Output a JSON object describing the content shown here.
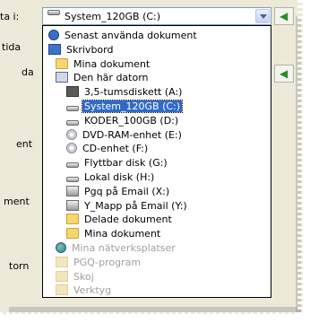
{
  "window": {
    "look_in_label": "ta i:",
    "selected_location": "System_120GB (C:)"
  },
  "left_labels": [
    "tida",
    "da",
    "ent",
    "ment",
    "torn"
  ],
  "dropdown": {
    "items": [
      {
        "label": "Senast använda dokument",
        "icon": "recent-documents-icon",
        "indent": 0,
        "selected": false,
        "dim": false
      },
      {
        "label": "Skrivbord",
        "icon": "desktop-icon",
        "indent": 0,
        "selected": false,
        "dim": false
      },
      {
        "label": "Mina dokument",
        "icon": "folder-icon",
        "indent": 1,
        "selected": false,
        "dim": false
      },
      {
        "label": "Den här datorn",
        "icon": "computer-icon",
        "indent": 1,
        "selected": false,
        "dim": false
      },
      {
        "label": "3,5-tumsdiskett (A:)",
        "icon": "floppy-drive-icon",
        "indent": 2,
        "selected": false,
        "dim": false
      },
      {
        "label": "System_120GB (C:)",
        "icon": "hard-drive-icon",
        "indent": 2,
        "selected": true,
        "dim": false
      },
      {
        "label": "KODER_100GB (D:)",
        "icon": "hard-drive-icon",
        "indent": 2,
        "selected": false,
        "dim": false
      },
      {
        "label": "DVD-RAM-enhet (E:)",
        "icon": "dvd-drive-icon",
        "indent": 2,
        "selected": false,
        "dim": false
      },
      {
        "label": "CD-enhet (F:)",
        "icon": "cd-drive-icon",
        "indent": 2,
        "selected": false,
        "dim": false
      },
      {
        "label": "Flyttbar disk (G:)",
        "icon": "removable-disk-icon",
        "indent": 2,
        "selected": false,
        "dim": false
      },
      {
        "label": "Lokal disk (H:)",
        "icon": "hard-drive-icon",
        "indent": 2,
        "selected": false,
        "dim": false
      },
      {
        "label": "Pgq på Email (X:)",
        "icon": "network-drive-icon",
        "indent": 2,
        "selected": false,
        "dim": false
      },
      {
        "label": "Y_Mapp på Email (Y:)",
        "icon": "network-drive-icon",
        "indent": 2,
        "selected": false,
        "dim": false
      },
      {
        "label": "Delade dokument",
        "icon": "folder-icon",
        "indent": 2,
        "selected": false,
        "dim": false
      },
      {
        "label": "Mina dokument",
        "icon": "folder-icon",
        "indent": 2,
        "selected": false,
        "dim": false
      },
      {
        "label": "Mina nätverksplatser",
        "icon": "network-places-icon",
        "indent": 1,
        "selected": false,
        "dim": true
      },
      {
        "label": "PGQ-program",
        "icon": "folder-icon",
        "indent": 1,
        "selected": false,
        "dim": true
      },
      {
        "label": "Skoj",
        "icon": "folder-icon",
        "indent": 1,
        "selected": false,
        "dim": true
      },
      {
        "label": "Verktyg",
        "icon": "folder-icon",
        "indent": 1,
        "selected": false,
        "dim": true
      }
    ]
  },
  "colors": {
    "selection": "#316ac5",
    "dialog_background": "#ece9d8"
  }
}
